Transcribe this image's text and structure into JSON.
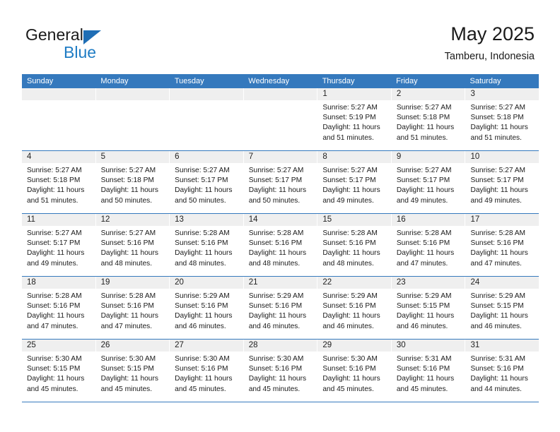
{
  "brand": {
    "name_top": "General",
    "name_bottom": "Blue",
    "accent_color": "#1f7cc4"
  },
  "header": {
    "title": "May 2025",
    "subtitle": "Tamberu, Indonesia"
  },
  "theme": {
    "header_row_bg": "#3579bd",
    "day_strip_bg": "#efefef",
    "row_divider": "#3579bd"
  },
  "weekdays": [
    "Sunday",
    "Monday",
    "Tuesday",
    "Wednesday",
    "Thursday",
    "Friday",
    "Saturday"
  ],
  "weeks": [
    [
      {
        "day": "",
        "empty": true
      },
      {
        "day": "",
        "empty": true
      },
      {
        "day": "",
        "empty": true
      },
      {
        "day": "",
        "empty": true
      },
      {
        "day": "1",
        "sunrise": "Sunrise: 5:27 AM",
        "sunset": "Sunset: 5:19 PM",
        "daylight1": "Daylight: 11 hours",
        "daylight2": "and 51 minutes."
      },
      {
        "day": "2",
        "sunrise": "Sunrise: 5:27 AM",
        "sunset": "Sunset: 5:18 PM",
        "daylight1": "Daylight: 11 hours",
        "daylight2": "and 51 minutes."
      },
      {
        "day": "3",
        "sunrise": "Sunrise: 5:27 AM",
        "sunset": "Sunset: 5:18 PM",
        "daylight1": "Daylight: 11 hours",
        "daylight2": "and 51 minutes."
      }
    ],
    [
      {
        "day": "4",
        "sunrise": "Sunrise: 5:27 AM",
        "sunset": "Sunset: 5:18 PM",
        "daylight1": "Daylight: 11 hours",
        "daylight2": "and 51 minutes."
      },
      {
        "day": "5",
        "sunrise": "Sunrise: 5:27 AM",
        "sunset": "Sunset: 5:18 PM",
        "daylight1": "Daylight: 11 hours",
        "daylight2": "and 50 minutes."
      },
      {
        "day": "6",
        "sunrise": "Sunrise: 5:27 AM",
        "sunset": "Sunset: 5:17 PM",
        "daylight1": "Daylight: 11 hours",
        "daylight2": "and 50 minutes."
      },
      {
        "day": "7",
        "sunrise": "Sunrise: 5:27 AM",
        "sunset": "Sunset: 5:17 PM",
        "daylight1": "Daylight: 11 hours",
        "daylight2": "and 50 minutes."
      },
      {
        "day": "8",
        "sunrise": "Sunrise: 5:27 AM",
        "sunset": "Sunset: 5:17 PM",
        "daylight1": "Daylight: 11 hours",
        "daylight2": "and 49 minutes."
      },
      {
        "day": "9",
        "sunrise": "Sunrise: 5:27 AM",
        "sunset": "Sunset: 5:17 PM",
        "daylight1": "Daylight: 11 hours",
        "daylight2": "and 49 minutes."
      },
      {
        "day": "10",
        "sunrise": "Sunrise: 5:27 AM",
        "sunset": "Sunset: 5:17 PM",
        "daylight1": "Daylight: 11 hours",
        "daylight2": "and 49 minutes."
      }
    ],
    [
      {
        "day": "11",
        "sunrise": "Sunrise: 5:27 AM",
        "sunset": "Sunset: 5:17 PM",
        "daylight1": "Daylight: 11 hours",
        "daylight2": "and 49 minutes."
      },
      {
        "day": "12",
        "sunrise": "Sunrise: 5:27 AM",
        "sunset": "Sunset: 5:16 PM",
        "daylight1": "Daylight: 11 hours",
        "daylight2": "and 48 minutes."
      },
      {
        "day": "13",
        "sunrise": "Sunrise: 5:28 AM",
        "sunset": "Sunset: 5:16 PM",
        "daylight1": "Daylight: 11 hours",
        "daylight2": "and 48 minutes."
      },
      {
        "day": "14",
        "sunrise": "Sunrise: 5:28 AM",
        "sunset": "Sunset: 5:16 PM",
        "daylight1": "Daylight: 11 hours",
        "daylight2": "and 48 minutes."
      },
      {
        "day": "15",
        "sunrise": "Sunrise: 5:28 AM",
        "sunset": "Sunset: 5:16 PM",
        "daylight1": "Daylight: 11 hours",
        "daylight2": "and 48 minutes."
      },
      {
        "day": "16",
        "sunrise": "Sunrise: 5:28 AM",
        "sunset": "Sunset: 5:16 PM",
        "daylight1": "Daylight: 11 hours",
        "daylight2": "and 47 minutes."
      },
      {
        "day": "17",
        "sunrise": "Sunrise: 5:28 AM",
        "sunset": "Sunset: 5:16 PM",
        "daylight1": "Daylight: 11 hours",
        "daylight2": "and 47 minutes."
      }
    ],
    [
      {
        "day": "18",
        "sunrise": "Sunrise: 5:28 AM",
        "sunset": "Sunset: 5:16 PM",
        "daylight1": "Daylight: 11 hours",
        "daylight2": "and 47 minutes."
      },
      {
        "day": "19",
        "sunrise": "Sunrise: 5:28 AM",
        "sunset": "Sunset: 5:16 PM",
        "daylight1": "Daylight: 11 hours",
        "daylight2": "and 47 minutes."
      },
      {
        "day": "20",
        "sunrise": "Sunrise: 5:29 AM",
        "sunset": "Sunset: 5:16 PM",
        "daylight1": "Daylight: 11 hours",
        "daylight2": "and 46 minutes."
      },
      {
        "day": "21",
        "sunrise": "Sunrise: 5:29 AM",
        "sunset": "Sunset: 5:16 PM",
        "daylight1": "Daylight: 11 hours",
        "daylight2": "and 46 minutes."
      },
      {
        "day": "22",
        "sunrise": "Sunrise: 5:29 AM",
        "sunset": "Sunset: 5:16 PM",
        "daylight1": "Daylight: 11 hours",
        "daylight2": "and 46 minutes."
      },
      {
        "day": "23",
        "sunrise": "Sunrise: 5:29 AM",
        "sunset": "Sunset: 5:15 PM",
        "daylight1": "Daylight: 11 hours",
        "daylight2": "and 46 minutes."
      },
      {
        "day": "24",
        "sunrise": "Sunrise: 5:29 AM",
        "sunset": "Sunset: 5:15 PM",
        "daylight1": "Daylight: 11 hours",
        "daylight2": "and 46 minutes."
      }
    ],
    [
      {
        "day": "25",
        "sunrise": "Sunrise: 5:30 AM",
        "sunset": "Sunset: 5:15 PM",
        "daylight1": "Daylight: 11 hours",
        "daylight2": "and 45 minutes."
      },
      {
        "day": "26",
        "sunrise": "Sunrise: 5:30 AM",
        "sunset": "Sunset: 5:15 PM",
        "daylight1": "Daylight: 11 hours",
        "daylight2": "and 45 minutes."
      },
      {
        "day": "27",
        "sunrise": "Sunrise: 5:30 AM",
        "sunset": "Sunset: 5:16 PM",
        "daylight1": "Daylight: 11 hours",
        "daylight2": "and 45 minutes."
      },
      {
        "day": "28",
        "sunrise": "Sunrise: 5:30 AM",
        "sunset": "Sunset: 5:16 PM",
        "daylight1": "Daylight: 11 hours",
        "daylight2": "and 45 minutes."
      },
      {
        "day": "29",
        "sunrise": "Sunrise: 5:30 AM",
        "sunset": "Sunset: 5:16 PM",
        "daylight1": "Daylight: 11 hours",
        "daylight2": "and 45 minutes."
      },
      {
        "day": "30",
        "sunrise": "Sunrise: 5:31 AM",
        "sunset": "Sunset: 5:16 PM",
        "daylight1": "Daylight: 11 hours",
        "daylight2": "and 45 minutes."
      },
      {
        "day": "31",
        "sunrise": "Sunrise: 5:31 AM",
        "sunset": "Sunset: 5:16 PM",
        "daylight1": "Daylight: 11 hours",
        "daylight2": "and 44 minutes."
      }
    ]
  ]
}
